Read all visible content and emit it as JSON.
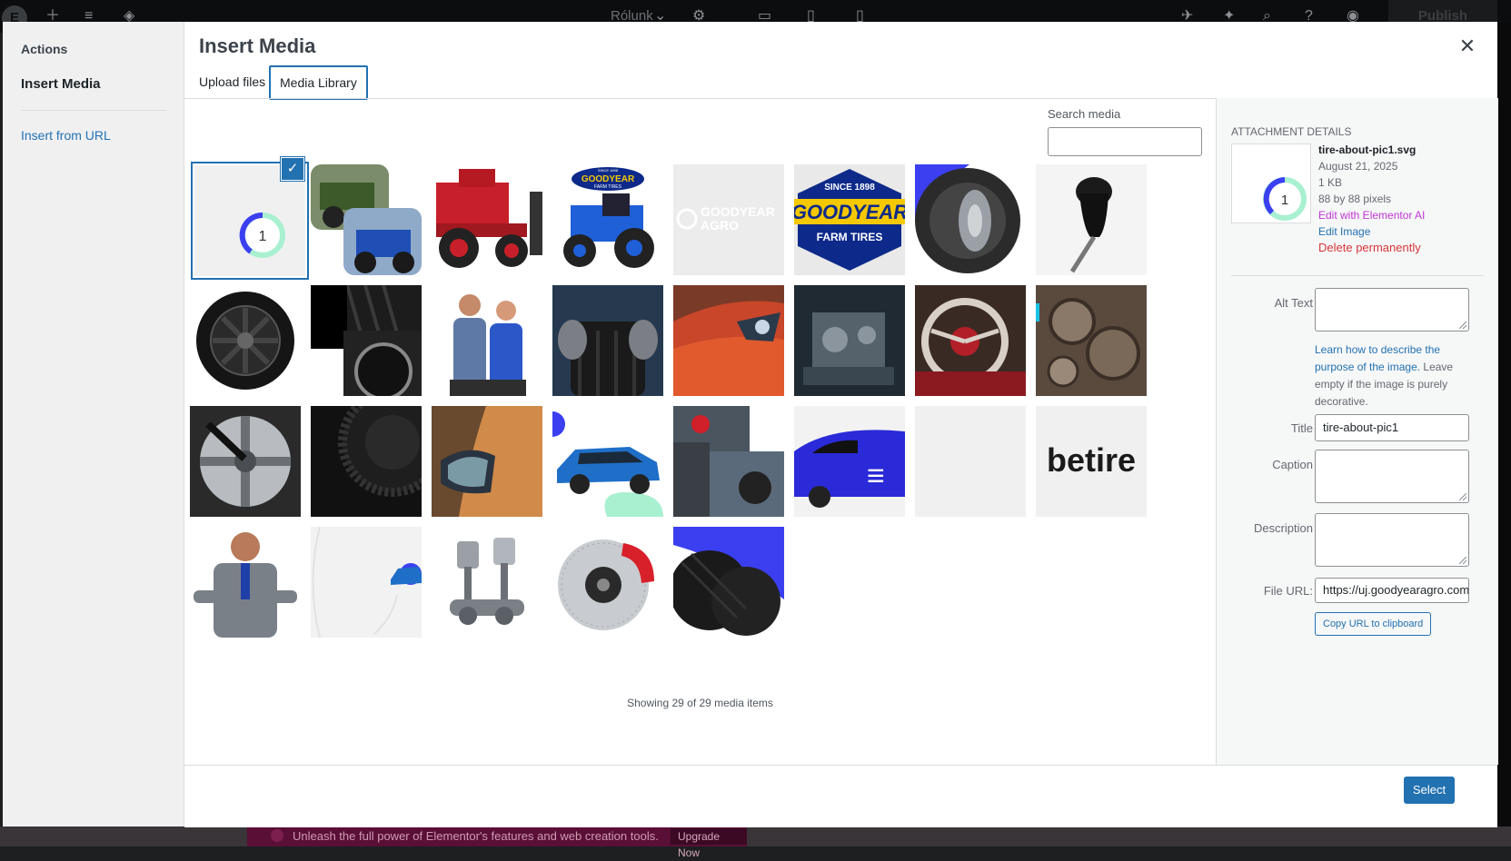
{
  "editor": {
    "logo": "E",
    "page_name": "Rólunk",
    "publish_label": "Publish",
    "promo_text": "Unleash the full power of Elementor's features and web creation tools.",
    "promo_button": "Upgrade Now"
  },
  "menu": {
    "heading": "Actions",
    "active_item": "Insert Media",
    "link_item": "Insert from URL"
  },
  "modal": {
    "title": "Insert Media",
    "close_icon": "close-icon",
    "tabs": [
      {
        "label": "Upload files",
        "active": false
      },
      {
        "label": "Media Library",
        "active": true
      }
    ],
    "search_label": "Search media",
    "search_value": "",
    "showing_text": "Showing 29 of 29 media items",
    "select_button": "Select"
  },
  "media_items": [
    {
      "name": "tire-about-pic1",
      "selected": true,
      "thumb_number": "1"
    },
    {
      "name": "tractors-collage"
    },
    {
      "name": "red-combine-harvester"
    },
    {
      "name": "goodyear-blue-tractor",
      "badge_small": "SINCE 1898",
      "badge_brand": "GOODYEAR",
      "badge_sub": "FARM TIRES"
    },
    {
      "name": "goodyear-agro-logo",
      "logo_text_1": "GOODYEAR",
      "logo_text_2": "AGRO"
    },
    {
      "name": "goodyear-farm-tires-badge",
      "badge_small": "SINCE 1898",
      "badge_brand": "GOODYEAR",
      "badge_sub": "FARM TIRES"
    },
    {
      "name": "tractor-tire-blue"
    },
    {
      "name": "gear-shift-knob"
    },
    {
      "name": "black-alloy-wheel"
    },
    {
      "name": "tires-collage"
    },
    {
      "name": "mechanics-couple"
    },
    {
      "name": "hands-holding-tire"
    },
    {
      "name": "red-car-headlight"
    },
    {
      "name": "engine-parts"
    },
    {
      "name": "red-steering-wheel"
    },
    {
      "name": "engine-gears"
    },
    {
      "name": "lug-wrench-wheel"
    },
    {
      "name": "tire-tread-closeup"
    },
    {
      "name": "car-side-mirror"
    },
    {
      "name": "blue-suv"
    },
    {
      "name": "mechanics-at-work"
    },
    {
      "name": "blue-car-wrap"
    },
    {
      "name": "blank-image"
    },
    {
      "name": "betire-logo",
      "logo_text": "betire"
    },
    {
      "name": "smiling-mechanic"
    },
    {
      "name": "small-blue-car"
    },
    {
      "name": "engine-pistons"
    },
    {
      "name": "brake-disc-red-caliper"
    },
    {
      "name": "tires-blue-corner"
    }
  ],
  "attachment": {
    "heading": "Attachment Details",
    "filename": "tire-about-pic1.svg",
    "date": "August 21, 2025",
    "size": "1 KB",
    "dimensions": "88 by 88 pixels",
    "edit_ai": "Edit with Elementor AI",
    "edit_image": "Edit Image",
    "delete": "Delete permanently",
    "thumb_number": "1",
    "alt_label": "Alt Text",
    "alt_value": "",
    "alt_help_link": "Learn how to describe the purpose of the image.",
    "alt_help_text": " Leave empty if the image is purely decorative.",
    "title_label": "Title",
    "title_value": "tire-about-pic1",
    "caption_label": "Caption",
    "caption_value": "",
    "description_label": "Description",
    "description_value": "",
    "file_url_label": "File URL:",
    "file_url_value": "https://uj.goodyearagro.com/",
    "copy_button": "Copy URL to clipboard"
  },
  "colors": {
    "primary": "#2271b1",
    "danger": "#d63638",
    "ai": "#c036d6",
    "ring_blue": "#3b3ff0",
    "ring_mint": "#a8f0d0"
  }
}
